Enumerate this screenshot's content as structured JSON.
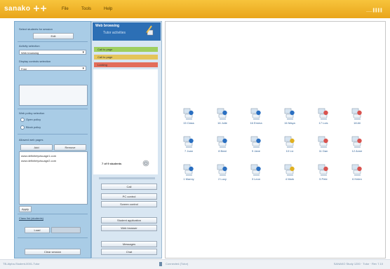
{
  "app": {
    "logo": "sanako",
    "menu": [
      "File",
      "Tools",
      "Help"
    ],
    "top_right": "___ ▌▌▌▌"
  },
  "left": {
    "select_students_label": "Select students for session",
    "edit_button": "Edit",
    "activity_label": "Activity selection",
    "activity_value": "Web browsing",
    "display_label": "Display controls selection",
    "display_value": "Free",
    "web_policy_label": "Web policy selection",
    "radio1": "Open policy",
    "radio2": "Block policy",
    "allowed_label": "Allowed web pages",
    "add_btn": "Add",
    "remove_btn": "Remove",
    "urls": [
      "www.definitelyvisuage1.com",
      "www.definitelyvisuage2.com"
    ],
    "apply_btn": "Apply",
    "classlist_label": "Class list (students)",
    "load_btn": "Load",
    "clear_btn": "Clear session"
  },
  "middle": {
    "title": "Web browsing",
    "subtitle": "Tutor activities",
    "bars": [
      {
        "label": "Call to page",
        "color": "#9fcf5f"
      },
      {
        "label": "Call to page",
        "color": "#e4c55a"
      },
      {
        "label": "Locking",
        "color": "#e36d5a"
      }
    ],
    "students_label": "7 of 9 students",
    "buttons": [
      "Call",
      "PC control",
      "Screen control",
      "Student application",
      "Web browser",
      "Messages",
      "Chat"
    ]
  },
  "students": [
    {
      "name": "15 Class",
      "color": "#2a6fc1"
    },
    {
      "name": "16 Julie",
      "color": "#2a6fc1"
    },
    {
      "name": "16 Emma",
      "color": "#2a6fc1"
    },
    {
      "name": "16 Maya",
      "color": "#2a6fc1"
    },
    {
      "name": "17 Luis",
      "color": "#d9534f"
    },
    {
      "name": "18 Ali",
      "color": "#d9534f"
    },
    {
      "name": "7 Joan",
      "color": "#2a6fc1"
    },
    {
      "name": "8 Beat",
      "color": "#2a6fc1"
    },
    {
      "name": "9 Jane",
      "color": "#2a6fc1"
    },
    {
      "name": "10 Liz",
      "color": "#e0b020"
    },
    {
      "name": "11 Dan",
      "color": "#d9534f"
    },
    {
      "name": "12 Anne",
      "color": "#d9534f"
    },
    {
      "name": "1 Manny",
      "color": "#2a6fc1"
    },
    {
      "name": "2 Lucy",
      "color": "#2a6fc1"
    },
    {
      "name": "3 Leon",
      "color": "#2a6fc1"
    },
    {
      "name": "4 Mark",
      "color": "#e0b020"
    },
    {
      "name": "5 Pete",
      "color": "#d9534f"
    },
    {
      "name": "6 Helen",
      "color": "#d9534f"
    }
  ],
  "status": {
    "left": "TB-Alpha-Student-0001-Tutor",
    "mid": "Connected (Tutor)",
    "right": "SANAKO Study 1200 · Tutor · Rev 7.10"
  }
}
